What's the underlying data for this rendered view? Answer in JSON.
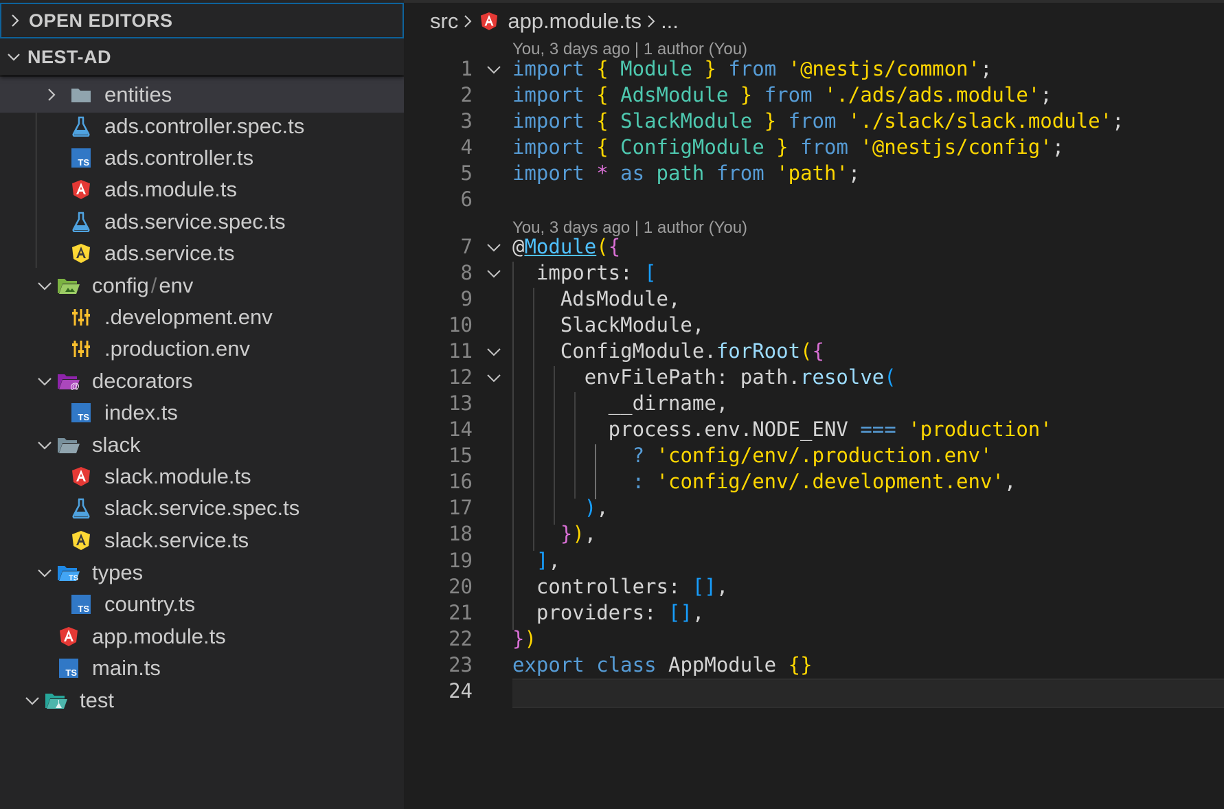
{
  "sidebar": {
    "open_editors_label": "OPEN EDITORS",
    "project_label": "NEST-AD",
    "items": [
      {
        "label": "entities",
        "icon": "folder-icon",
        "twisty": "chevron-right"
      },
      {
        "label": "ads.controller.spec.ts",
        "icon": "test-flask-icon"
      },
      {
        "label": "ads.controller.ts",
        "icon": "typescript-file-icon"
      },
      {
        "label": "ads.module.ts",
        "icon": "angular-module-icon"
      },
      {
        "label": "ads.service.spec.ts",
        "icon": "test-flask-icon"
      },
      {
        "label": "ads.service.ts",
        "icon": "angular-service-icon"
      },
      {
        "label_a": "config",
        "label_sep": "/",
        "label_b": "env",
        "icon": "config-folder-open-icon",
        "twisty": "chevron-down"
      },
      {
        "label": ".development.env",
        "icon": "env-settings-icon"
      },
      {
        "label": ".production.env",
        "icon": "env-settings-icon"
      },
      {
        "label": "decorators",
        "icon": "decorators-folder-open-icon",
        "twisty": "chevron-down"
      },
      {
        "label": "index.ts",
        "icon": "typescript-file-icon"
      },
      {
        "label": "slack",
        "icon": "folder-open-icon",
        "twisty": "chevron-down"
      },
      {
        "label": "slack.module.ts",
        "icon": "angular-module-icon"
      },
      {
        "label": "slack.service.spec.ts",
        "icon": "test-flask-icon"
      },
      {
        "label": "slack.service.ts",
        "icon": "angular-service-icon"
      },
      {
        "label": "types",
        "icon": "types-folder-open-icon",
        "twisty": "chevron-down"
      },
      {
        "label": "country.ts",
        "icon": "typescript-file-icon"
      },
      {
        "label": "app.module.ts",
        "icon": "angular-module-icon"
      },
      {
        "label": "main.ts",
        "icon": "typescript-file-icon"
      },
      {
        "label": "test",
        "icon": "test-folder-open-icon",
        "twisty": "chevron-down"
      }
    ]
  },
  "editor": {
    "breadcrumb": {
      "folder": "src",
      "file": "app.module.ts",
      "more": "..."
    },
    "codelens": [
      "You, 3 days ago | 1 author (You)",
      "You, 3 days ago | 1 author (You)"
    ],
    "line_numbers": [
      "1",
      "2",
      "3",
      "4",
      "5",
      "6",
      "7",
      "8",
      "9",
      "10",
      "11",
      "12",
      "13",
      "14",
      "15",
      "16",
      "17",
      "18",
      "19",
      "20",
      "21",
      "22",
      "23",
      "24"
    ],
    "code": {
      "l1": [
        "import",
        " ",
        "{",
        " Module ",
        "}",
        " from ",
        "'@nestjs/common'",
        ";"
      ],
      "l2": [
        "import",
        " ",
        "{",
        " AdsModule ",
        "}",
        " from ",
        "'./ads/ads.module'",
        ";"
      ],
      "l3": [
        "import",
        " ",
        "{",
        " SlackModule ",
        "}",
        " from ",
        "'./slack/slack.module'",
        ";"
      ],
      "l4": [
        "import",
        " ",
        "{",
        " ConfigModule ",
        "}",
        " from ",
        "'@nestjs/config'",
        ";"
      ],
      "l5": [
        "import",
        " ",
        "*",
        " as ",
        "path",
        " from ",
        "'path'",
        ";"
      ],
      "l7": [
        "@",
        "Module",
        "(",
        "{"
      ],
      "l8": [
        "  imports: ",
        "["
      ],
      "l9": [
        "    AdsModule,"
      ],
      "l10": [
        "    SlackModule,"
      ],
      "l11": [
        "    ConfigModule.",
        "forRoot",
        "(",
        "{"
      ],
      "l12": [
        "      envFilePath: path.",
        "resolve",
        "("
      ],
      "l13": [
        "        __dirname,"
      ],
      "l14": [
        "        process.env.NODE_ENV ",
        "===",
        " ",
        "'production'"
      ],
      "l15": [
        "          ",
        "?",
        " ",
        "'config/env/.production.env'"
      ],
      "l16": [
        "          ",
        ":",
        " ",
        "'config/env/.development.env'",
        ","
      ],
      "l17": [
        "      ",
        ")",
        ","
      ],
      "l18": [
        "    ",
        "}",
        ")",
        ","
      ],
      "l19": [
        "  ",
        "]",
        ","
      ],
      "l20": [
        "  controllers: ",
        "[]",
        ","
      ],
      "l21": [
        "  providers: ",
        "[]",
        ","
      ],
      "l22": [
        "}",
        ")"
      ],
      "l23": [
        "export",
        " ",
        "class",
        " AppModule ",
        "{}"
      ]
    }
  },
  "colors": {
    "keyword": "#c586c0",
    "string": "#ce9178",
    "type": "#4ec9b0",
    "bracket_gold": "#ffd700",
    "bracket_pink": "#da70d6",
    "bracket_blue": "#179fff",
    "accent": "#0e639c"
  }
}
